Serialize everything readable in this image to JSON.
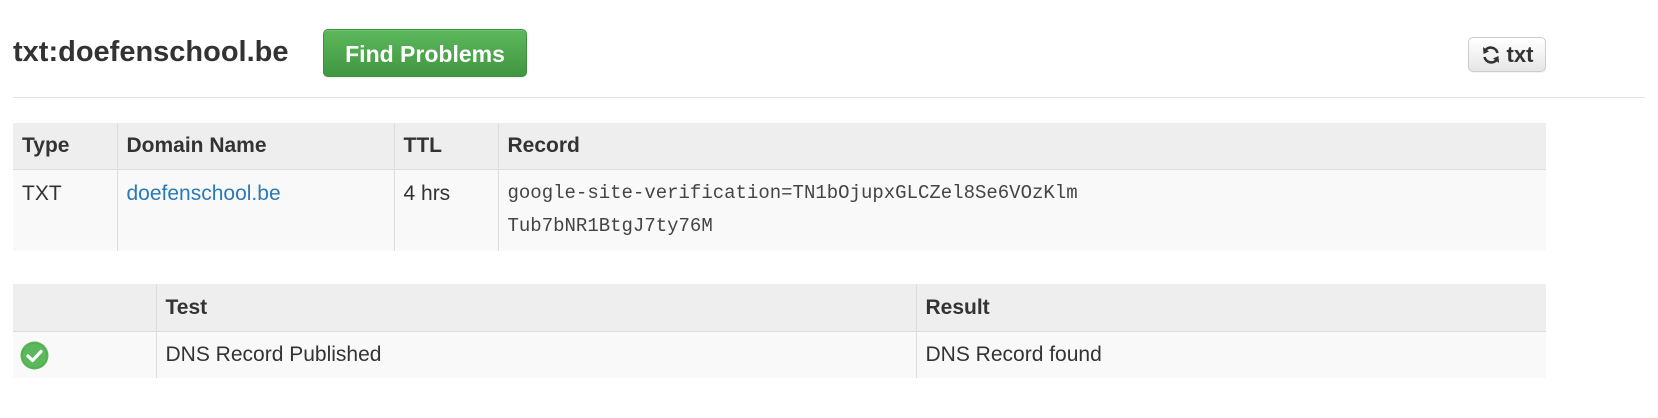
{
  "header": {
    "title": "txt:doefenschool.be",
    "find_problems_label": "Find Problems",
    "refresh_label": "txt",
    "refresh_icon": "refresh-icon"
  },
  "record_table": {
    "columns": [
      "Type",
      "Domain Name",
      "TTL",
      "Record"
    ],
    "rows": [
      {
        "type": "TXT",
        "domain": "doefenschool.be",
        "ttl": "4 hrs",
        "record_line1": "google-site-verification=TN1bOjupxGLCZel8Se6VOzKlm",
        "record_line2": "Tub7bNR1BtgJ7ty76M"
      }
    ]
  },
  "test_table": {
    "columns": [
      "",
      "Test",
      "Result"
    ],
    "rows": [
      {
        "status_icon": "check-circle-icon",
        "status_color": "#5cb85c",
        "test": "DNS Record Published",
        "result": "DNS Record found"
      }
    ]
  },
  "colors": {
    "accent_green": "#5cb85c",
    "link_blue": "#2a7ab8",
    "header_bg": "#eeeeee",
    "row_bg": "#f9f9f9"
  }
}
